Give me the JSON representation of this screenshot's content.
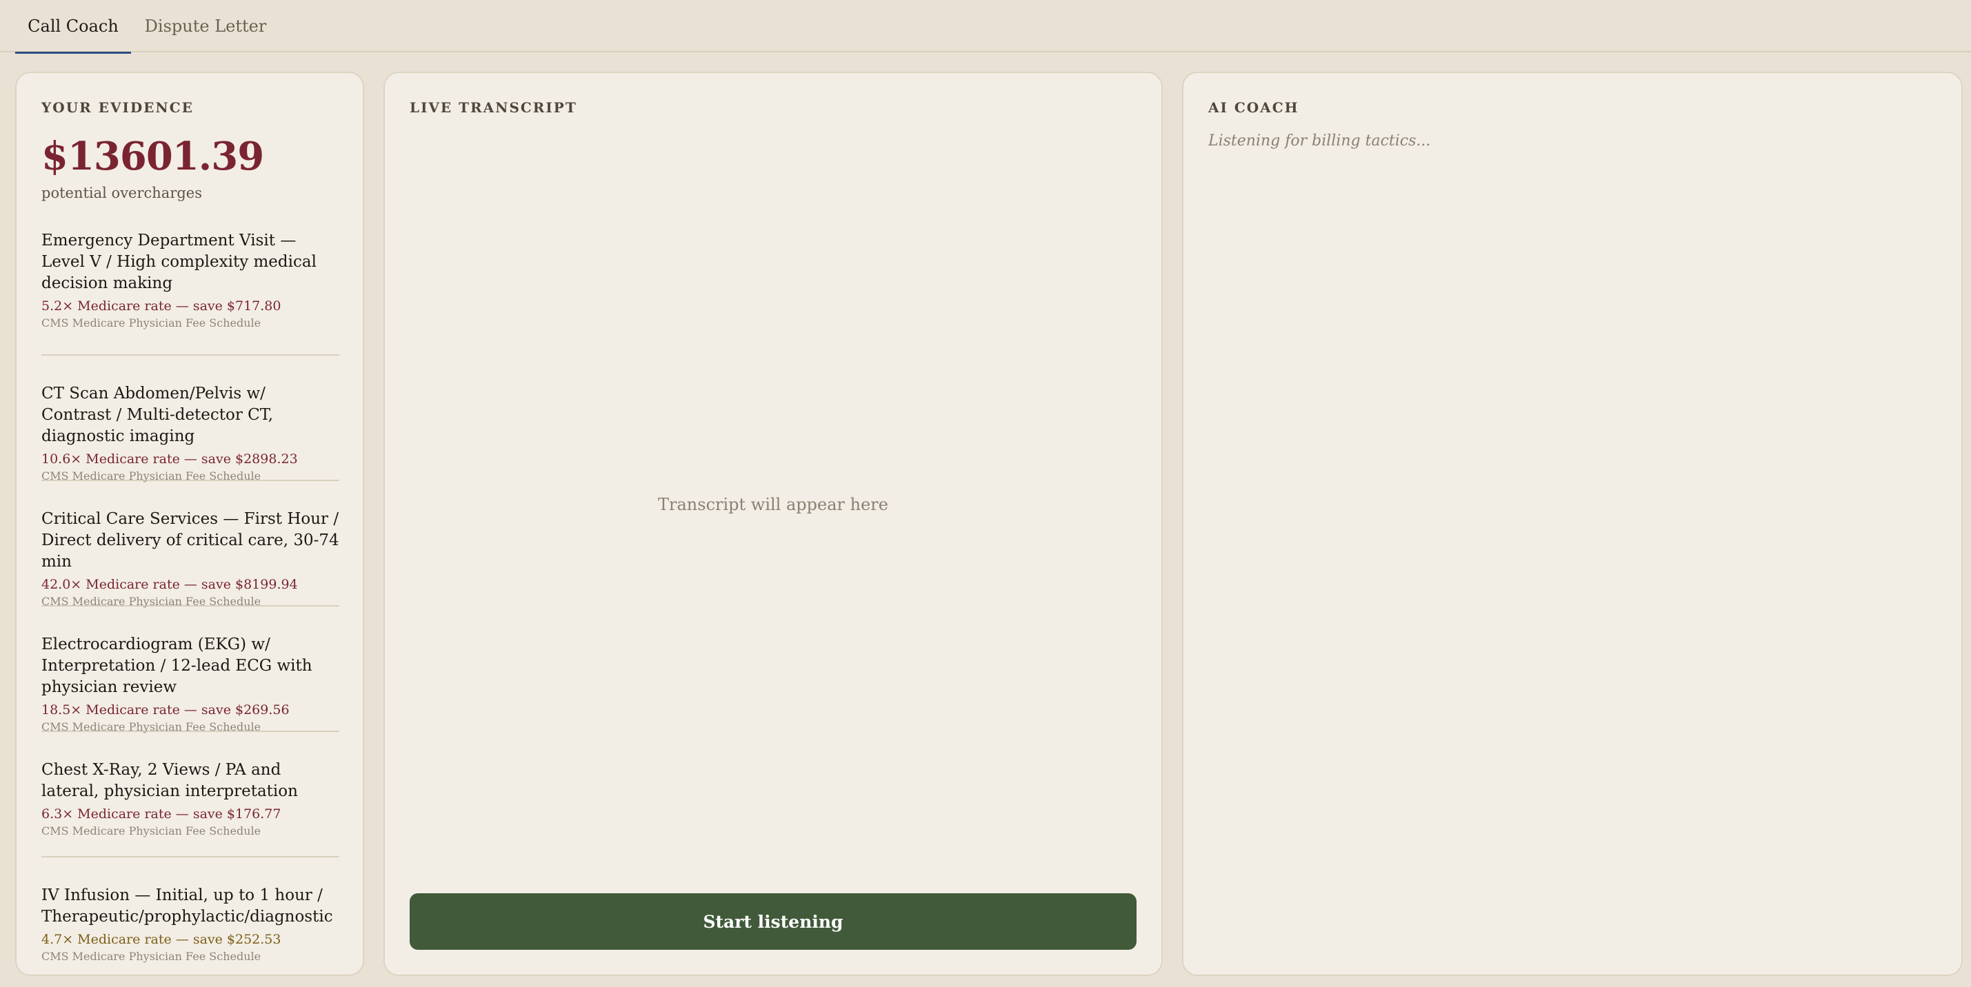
{
  "tabs": [
    {
      "label": "Call Coach",
      "active": true
    },
    {
      "label": "Dispute Letter",
      "active": false
    }
  ],
  "evidence": {
    "title": "YOUR EVIDENCE",
    "total": "$13601.39",
    "total_label": "potential overcharges",
    "items": [
      {
        "name": "Emergency Department Visit — Level V / High complexity medical decision making",
        "rate": "5.2× Medicare rate — save $717.80",
        "source": "CMS Medicare Physician Fee Schedule"
      },
      {
        "name": "CT Scan Abdomen/Pelvis w/ Contrast / Multi-detector CT, diagnostic imaging",
        "rate": "10.6× Medicare rate — save $2898.23",
        "source": "CMS Medicare Physician Fee Schedule"
      },
      {
        "name": "Critical Care Services — First Hour / Direct delivery of critical care, 30-74 min",
        "rate": "42.0× Medicare rate — save $8199.94",
        "source": "CMS Medicare Physician Fee Schedule"
      },
      {
        "name": "Electrocardiogram (EKG) w/ Interpretation / 12-lead ECG with physician review",
        "rate": "18.5× Medicare rate — save $269.56",
        "source": "CMS Medicare Physician Fee Schedule"
      },
      {
        "name": "Chest X-Ray, 2 Views / PA and lateral, physician interpretation",
        "rate": "6.3× Medicare rate — save $176.77",
        "source": "CMS Medicare Physician Fee Schedule"
      },
      {
        "name": "IV Infusion — Initial, up to 1 hour / Therapeutic/prophylactic/diagnostic",
        "rate": "4.7× Medicare rate — save $252.53",
        "source": "CMS Medicare Physician Fee Schedule"
      }
    ]
  },
  "transcript": {
    "title": "LIVE TRANSCRIPT",
    "placeholder": "Transcript will appear here",
    "start_button": "Start listening"
  },
  "coach": {
    "title": "AI COACH",
    "status": "Listening for billing tactics..."
  },
  "colors": {
    "accent_red": "#7a2431",
    "button_green": "#415a3a",
    "tab_underline": "#2f4f86",
    "amber": "#7d5c17"
  }
}
